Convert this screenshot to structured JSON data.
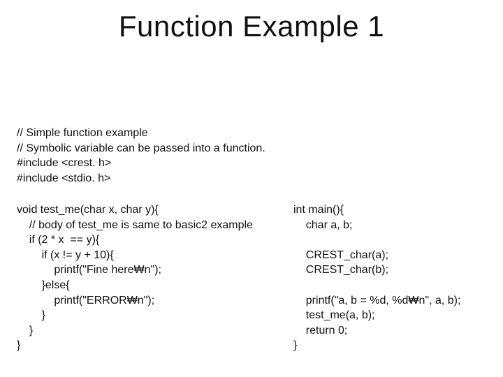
{
  "title": "Function Example 1",
  "comments": "// Simple function example\n// Symbolic variable can be passed into a function.\n#include <crest. h>\n#include <stdio. h>",
  "left_code": "void test_me(char x, char y){\n    // body of test_me is same to basic2 example\n    if (2 * x  == y){\n        if (x != y + 10){\n            printf(\"Fine here₩n\");\n        }else{\n            printf(\"ERROR₩n\");\n        }\n    }\n}",
  "right_code": "int main(){\n    char a, b;\n\n    CREST_char(a);\n    CREST_char(b);\n\n    printf(\"a, b = %d, %d₩n\", a, b);\n    test_me(a, b);\n    return 0;\n}"
}
